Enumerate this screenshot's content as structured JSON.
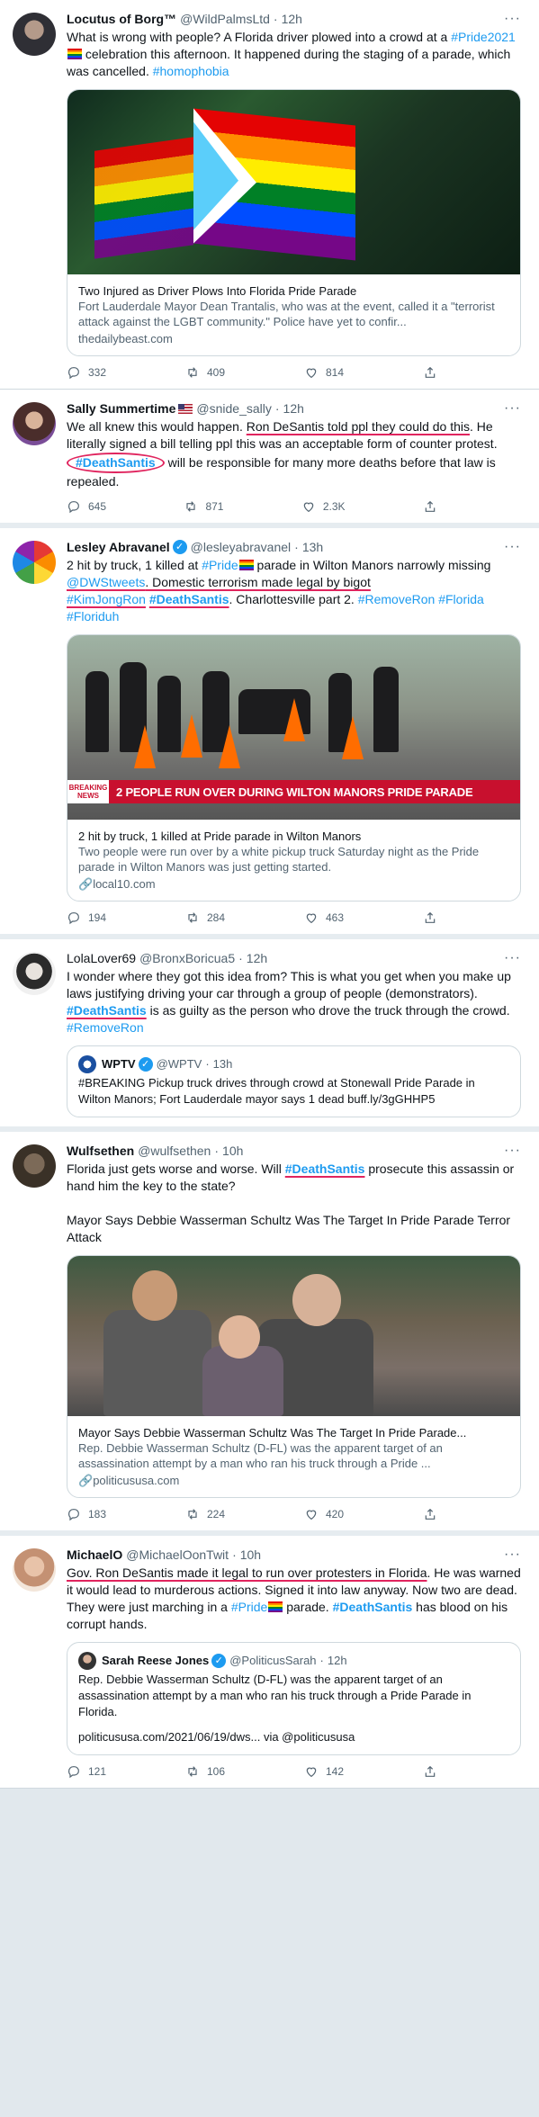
{
  "tweets": [
    {
      "name": "Locutus of Borg™",
      "handle": "@WildPalmsLtd",
      "time": "12h",
      "text_1": "What is wrong with people? A Florida driver plowed into a crowd at a",
      "hashtag_pride": "#Pride2021",
      "text_2": " celebration this afternoon. It happened during the staging of a parade, which was cancelled. ",
      "hashtag_2": "#homophobia",
      "card": {
        "title": "Two Injured as Driver Plows Into Florida Pride Parade",
        "desc": "Fort Lauderdale Mayor Dean Trantalis, who was at the event, called it a \"terrorist attack against the LGBT community.\" Police have yet to confir...",
        "url": "thedailybeast.com"
      },
      "replies": "332",
      "retweets": "409",
      "likes": "814"
    },
    {
      "name": "Sally Summertime",
      "handle": "@snide_sally",
      "time": "12h",
      "text_1": "We all knew this would happen. ",
      "text_underlined": "Ron DeSantis told ppl they could do this",
      "text_2": ". He literally signed a bill telling ppl this was an acceptable form of counter protest.",
      "hashtag_circled": "#DeathSantis",
      "text_3": " will be responsible for many more deaths before that law is repealed.",
      "replies": "645",
      "retweets": "871",
      "likes": "2.3K"
    },
    {
      "name": "Lesley Abravanel",
      "handle": "@lesleyabravanel",
      "time": "13h",
      "text_1": "2 hit by truck, 1 killed at ",
      "hashtag_pride": "#Pride",
      "text_2": " parade in Wilton Manors narrowly missing ",
      "mention": "@DWStweets",
      "text_underlined": ". Domestic terrorism made legal by bigot",
      "hashtag_kim": "#KimJongRon",
      "hashtag_death": "#DeathSantis",
      "text_3": ". Charlottesville part 2. ",
      "hashtag_remove": "#RemoveRon",
      "hashtag_florida": "#Florida",
      "hashtag_floriduh": "#Floriduh",
      "card": {
        "banner_tag": "BREAKING NEWS",
        "banner_text": "2 PEOPLE RUN OVER DURING WILTON MANORS PRIDE PARADE",
        "title": "2 hit by truck, 1 killed at Pride parade in Wilton Manors",
        "desc": "Two people were run over by a white pickup truck Saturday night as the Pride parade in Wilton Manors was just getting started.",
        "url": "local10.com"
      },
      "replies": "194",
      "retweets": "284",
      "likes": "463"
    },
    {
      "name": "LolaLover69",
      "handle": "@BronxBoricua5",
      "time": "12h",
      "text_1": "I wonder where they got this idea from? This is what you get when you make up laws justifying driving your car through a group of people (demonstrators). ",
      "hashtag_death": "#DeathSantis",
      "text_2": " is as guilty as the person who drove the truck through the crowd. ",
      "hashtag_remove": "#RemoveRon",
      "quote": {
        "name": "WPTV",
        "handle": "@WPTV",
        "time": "13h",
        "text": "#BREAKING Pickup truck drives through crowd at Stonewall Pride Parade in Wilton Manors; Fort Lauderdale mayor says 1 dead buff.ly/3gGHHP5"
      }
    },
    {
      "name": "Wulfsethen",
      "handle": "@wulfsethen",
      "time": "10h",
      "text_1": "Florida just gets worse and worse. Will ",
      "hashtag_death": "#DeathSantis",
      "text_2": " prosecute this assassin or hand him the key to the state?",
      "text_3": "Mayor Says Debbie Wasserman Schultz Was The Target In Pride Parade Terror Attack",
      "card": {
        "title": "Mayor Says Debbie Wasserman Schultz Was The Target In Pride Parade...",
        "desc": "Rep. Debbie Wasserman Schultz (D-FL) was the apparent target of an assassination attempt by a man who ran his truck through a Pride ...",
        "url": "politicususa.com"
      },
      "replies": "183",
      "retweets": "224",
      "likes": "420"
    },
    {
      "name": "MichaelO",
      "handle": "@MichaelOonTwit",
      "time": "10h",
      "text_underlined": "Gov. Ron DeSantis made it legal to run over protesters in Florida",
      "text_1": ". He was warned it would lead to murderous actions. Signed it into law anyway. Now two are dead. They were just marching in a ",
      "hashtag_pride": "#Pride",
      "text_2": " parade. ",
      "hashtag_death": "#DeathSantis",
      "text_3": " has blood on his corrupt hands.",
      "quote": {
        "name": "Sarah Reese Jones",
        "handle": "@PoliticusSarah",
        "time": "12h",
        "text": "Rep. Debbie Wasserman Schultz (D-FL) was the apparent target of an assassination attempt by a man who ran his truck through a Pride Parade in Florida.",
        "link": "politicususa.com/2021/06/19/dws... via @politicususa"
      },
      "replies": "121",
      "retweets": "106",
      "likes": "142"
    }
  ],
  "ui": {
    "separator": "·",
    "more": "···",
    "verified_mark": "✓",
    "link_icon": "🔗"
  }
}
